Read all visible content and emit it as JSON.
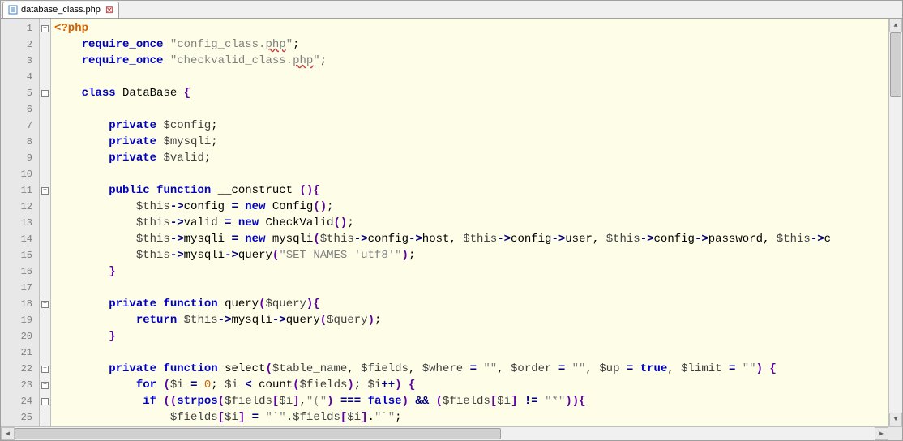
{
  "tab": {
    "filename": "database_class.php",
    "close_glyph": "⊠"
  },
  "gutter": {
    "start": 1,
    "end": 25
  },
  "fold_markers": {
    "1": "minus",
    "5": "minus",
    "11": "minus",
    "18": "minus",
    "22": "minus",
    "23": "minus",
    "24": "minus"
  },
  "code": {
    "lines": [
      [
        {
          "t": "tag",
          "v": "<?php"
        }
      ],
      [
        {
          "t": "sp",
          "v": "    "
        },
        {
          "t": "keyword",
          "v": "require_once"
        },
        {
          "t": "sp",
          "v": " "
        },
        {
          "t": "string",
          "v": "\"config_class."
        },
        {
          "t": "err",
          "v": "php"
        },
        {
          "t": "string",
          "v": "\""
        },
        {
          "t": "ident",
          "v": ";"
        }
      ],
      [
        {
          "t": "sp",
          "v": "    "
        },
        {
          "t": "keyword",
          "v": "require_once"
        },
        {
          "t": "sp",
          "v": " "
        },
        {
          "t": "string",
          "v": "\"checkvalid_class."
        },
        {
          "t": "err",
          "v": "php"
        },
        {
          "t": "string",
          "v": "\""
        },
        {
          "t": "ident",
          "v": ";"
        }
      ],
      [],
      [
        {
          "t": "sp",
          "v": "    "
        },
        {
          "t": "keyword",
          "v": "class"
        },
        {
          "t": "sp",
          "v": " "
        },
        {
          "t": "ident",
          "v": "DataBase "
        },
        {
          "t": "paren",
          "v": "{"
        }
      ],
      [],
      [
        {
          "t": "sp",
          "v": "        "
        },
        {
          "t": "keyword",
          "v": "private"
        },
        {
          "t": "sp",
          "v": " "
        },
        {
          "t": "var",
          "v": "$config"
        },
        {
          "t": "ident",
          "v": ";"
        }
      ],
      [
        {
          "t": "sp",
          "v": "        "
        },
        {
          "t": "keyword",
          "v": "private"
        },
        {
          "t": "sp",
          "v": " "
        },
        {
          "t": "var",
          "v": "$mysqli"
        },
        {
          "t": "ident",
          "v": ";"
        }
      ],
      [
        {
          "t": "sp",
          "v": "        "
        },
        {
          "t": "keyword",
          "v": "private"
        },
        {
          "t": "sp",
          "v": " "
        },
        {
          "t": "var",
          "v": "$valid"
        },
        {
          "t": "ident",
          "v": ";"
        }
      ],
      [],
      [
        {
          "t": "sp",
          "v": "        "
        },
        {
          "t": "keyword",
          "v": "public"
        },
        {
          "t": "sp",
          "v": " "
        },
        {
          "t": "keyword",
          "v": "function"
        },
        {
          "t": "sp",
          "v": " "
        },
        {
          "t": "func",
          "v": "__construct "
        },
        {
          "t": "paren",
          "v": "()"
        },
        {
          "t": "paren",
          "v": "{"
        }
      ],
      [
        {
          "t": "sp",
          "v": "            "
        },
        {
          "t": "var",
          "v": "$this"
        },
        {
          "t": "op",
          "v": "->"
        },
        {
          "t": "ident",
          "v": "config "
        },
        {
          "t": "op",
          "v": "="
        },
        {
          "t": "sp",
          "v": " "
        },
        {
          "t": "keyword",
          "v": "new"
        },
        {
          "t": "sp",
          "v": " "
        },
        {
          "t": "ident",
          "v": "Config"
        },
        {
          "t": "paren",
          "v": "()"
        },
        {
          "t": "ident",
          "v": ";"
        }
      ],
      [
        {
          "t": "sp",
          "v": "            "
        },
        {
          "t": "var",
          "v": "$this"
        },
        {
          "t": "op",
          "v": "->"
        },
        {
          "t": "ident",
          "v": "valid "
        },
        {
          "t": "op",
          "v": "="
        },
        {
          "t": "sp",
          "v": " "
        },
        {
          "t": "keyword",
          "v": "new"
        },
        {
          "t": "sp",
          "v": " "
        },
        {
          "t": "ident",
          "v": "CheckValid"
        },
        {
          "t": "paren",
          "v": "()"
        },
        {
          "t": "ident",
          "v": ";"
        }
      ],
      [
        {
          "t": "sp",
          "v": "            "
        },
        {
          "t": "var",
          "v": "$this"
        },
        {
          "t": "op",
          "v": "->"
        },
        {
          "t": "ident",
          "v": "mysqli "
        },
        {
          "t": "op",
          "v": "="
        },
        {
          "t": "sp",
          "v": " "
        },
        {
          "t": "keyword",
          "v": "new"
        },
        {
          "t": "sp",
          "v": " "
        },
        {
          "t": "ident",
          "v": "mysqli"
        },
        {
          "t": "paren",
          "v": "("
        },
        {
          "t": "var",
          "v": "$this"
        },
        {
          "t": "op",
          "v": "->"
        },
        {
          "t": "ident",
          "v": "config"
        },
        {
          "t": "op",
          "v": "->"
        },
        {
          "t": "ident",
          "v": "host"
        },
        {
          "t": "ident",
          "v": ", "
        },
        {
          "t": "var",
          "v": "$this"
        },
        {
          "t": "op",
          "v": "->"
        },
        {
          "t": "ident",
          "v": "config"
        },
        {
          "t": "op",
          "v": "->"
        },
        {
          "t": "ident",
          "v": "user"
        },
        {
          "t": "ident",
          "v": ", "
        },
        {
          "t": "var",
          "v": "$this"
        },
        {
          "t": "op",
          "v": "->"
        },
        {
          "t": "ident",
          "v": "config"
        },
        {
          "t": "op",
          "v": "->"
        },
        {
          "t": "ident",
          "v": "password"
        },
        {
          "t": "ident",
          "v": ", "
        },
        {
          "t": "var",
          "v": "$this"
        },
        {
          "t": "op",
          "v": "->"
        },
        {
          "t": "ident",
          "v": "c"
        }
      ],
      [
        {
          "t": "sp",
          "v": "            "
        },
        {
          "t": "var",
          "v": "$this"
        },
        {
          "t": "op",
          "v": "->"
        },
        {
          "t": "ident",
          "v": "mysqli"
        },
        {
          "t": "op",
          "v": "->"
        },
        {
          "t": "ident",
          "v": "query"
        },
        {
          "t": "paren",
          "v": "("
        },
        {
          "t": "string",
          "v": "\"SET NAMES 'utf8'\""
        },
        {
          "t": "paren",
          "v": ")"
        },
        {
          "t": "ident",
          "v": ";"
        }
      ],
      [
        {
          "t": "sp",
          "v": "        "
        },
        {
          "t": "paren",
          "v": "}"
        }
      ],
      [],
      [
        {
          "t": "sp",
          "v": "        "
        },
        {
          "t": "keyword",
          "v": "private"
        },
        {
          "t": "sp",
          "v": " "
        },
        {
          "t": "keyword",
          "v": "function"
        },
        {
          "t": "sp",
          "v": " "
        },
        {
          "t": "func",
          "v": "query"
        },
        {
          "t": "paren",
          "v": "("
        },
        {
          "t": "var",
          "v": "$query"
        },
        {
          "t": "paren",
          "v": ")"
        },
        {
          "t": "paren",
          "v": "{"
        }
      ],
      [
        {
          "t": "sp",
          "v": "            "
        },
        {
          "t": "keyword",
          "v": "return"
        },
        {
          "t": "sp",
          "v": " "
        },
        {
          "t": "var",
          "v": "$this"
        },
        {
          "t": "op",
          "v": "->"
        },
        {
          "t": "ident",
          "v": "mysqli"
        },
        {
          "t": "op",
          "v": "->"
        },
        {
          "t": "ident",
          "v": "query"
        },
        {
          "t": "paren",
          "v": "("
        },
        {
          "t": "var",
          "v": "$query"
        },
        {
          "t": "paren",
          "v": ")"
        },
        {
          "t": "ident",
          "v": ";"
        }
      ],
      [
        {
          "t": "sp",
          "v": "        "
        },
        {
          "t": "paren",
          "v": "}"
        }
      ],
      [],
      [
        {
          "t": "sp",
          "v": "        "
        },
        {
          "t": "keyword",
          "v": "private"
        },
        {
          "t": "sp",
          "v": " "
        },
        {
          "t": "keyword",
          "v": "function"
        },
        {
          "t": "sp",
          "v": " "
        },
        {
          "t": "func",
          "v": "select"
        },
        {
          "t": "paren",
          "v": "("
        },
        {
          "t": "var",
          "v": "$table_name"
        },
        {
          "t": "ident",
          "v": ", "
        },
        {
          "t": "var",
          "v": "$fields"
        },
        {
          "t": "ident",
          "v": ", "
        },
        {
          "t": "var",
          "v": "$where"
        },
        {
          "t": "sp",
          "v": " "
        },
        {
          "t": "op",
          "v": "="
        },
        {
          "t": "sp",
          "v": " "
        },
        {
          "t": "string",
          "v": "\"\""
        },
        {
          "t": "ident",
          "v": ", "
        },
        {
          "t": "var",
          "v": "$order"
        },
        {
          "t": "sp",
          "v": " "
        },
        {
          "t": "op",
          "v": "="
        },
        {
          "t": "sp",
          "v": " "
        },
        {
          "t": "string",
          "v": "\"\""
        },
        {
          "t": "ident",
          "v": ", "
        },
        {
          "t": "var",
          "v": "$up"
        },
        {
          "t": "sp",
          "v": " "
        },
        {
          "t": "op",
          "v": "="
        },
        {
          "t": "sp",
          "v": " "
        },
        {
          "t": "keyword",
          "v": "true"
        },
        {
          "t": "ident",
          "v": ", "
        },
        {
          "t": "var",
          "v": "$limit"
        },
        {
          "t": "sp",
          "v": " "
        },
        {
          "t": "op",
          "v": "="
        },
        {
          "t": "sp",
          "v": " "
        },
        {
          "t": "string",
          "v": "\"\""
        },
        {
          "t": "paren",
          "v": ")"
        },
        {
          "t": "sp",
          "v": " "
        },
        {
          "t": "paren",
          "v": "{"
        }
      ],
      [
        {
          "t": "sp",
          "v": "            "
        },
        {
          "t": "keyword",
          "v": "for"
        },
        {
          "t": "sp",
          "v": " "
        },
        {
          "t": "paren",
          "v": "("
        },
        {
          "t": "var",
          "v": "$i"
        },
        {
          "t": "sp",
          "v": " "
        },
        {
          "t": "op",
          "v": "="
        },
        {
          "t": "sp",
          "v": " "
        },
        {
          "t": "num",
          "v": "0"
        },
        {
          "t": "ident",
          "v": "; "
        },
        {
          "t": "var",
          "v": "$i"
        },
        {
          "t": "sp",
          "v": " "
        },
        {
          "t": "op",
          "v": "<"
        },
        {
          "t": "sp",
          "v": " "
        },
        {
          "t": "ident",
          "v": "count"
        },
        {
          "t": "paren",
          "v": "("
        },
        {
          "t": "var",
          "v": "$fields"
        },
        {
          "t": "paren",
          "v": ")"
        },
        {
          "t": "ident",
          "v": "; "
        },
        {
          "t": "var",
          "v": "$i"
        },
        {
          "t": "op",
          "v": "++"
        },
        {
          "t": "paren",
          "v": ")"
        },
        {
          "t": "sp",
          "v": " "
        },
        {
          "t": "paren",
          "v": "{"
        }
      ],
      [
        {
          "t": "sp",
          "v": "             "
        },
        {
          "t": "keyword",
          "v": "if"
        },
        {
          "t": "sp",
          "v": " "
        },
        {
          "t": "paren",
          "v": "(("
        },
        {
          "t": "keyword",
          "v": "strpos"
        },
        {
          "t": "paren",
          "v": "("
        },
        {
          "t": "var",
          "v": "$fields"
        },
        {
          "t": "paren",
          "v": "["
        },
        {
          "t": "var",
          "v": "$i"
        },
        {
          "t": "paren",
          "v": "]"
        },
        {
          "t": "ident",
          "v": ","
        },
        {
          "t": "string",
          "v": "\"(\""
        },
        {
          "t": "paren",
          "v": ")"
        },
        {
          "t": "sp",
          "v": " "
        },
        {
          "t": "op",
          "v": "==="
        },
        {
          "t": "sp",
          "v": " "
        },
        {
          "t": "keyword",
          "v": "false"
        },
        {
          "t": "paren",
          "v": ")"
        },
        {
          "t": "sp",
          "v": " "
        },
        {
          "t": "op",
          "v": "&&"
        },
        {
          "t": "sp",
          "v": " "
        },
        {
          "t": "paren",
          "v": "("
        },
        {
          "t": "var",
          "v": "$fields"
        },
        {
          "t": "paren",
          "v": "["
        },
        {
          "t": "var",
          "v": "$i"
        },
        {
          "t": "paren",
          "v": "]"
        },
        {
          "t": "sp",
          "v": " "
        },
        {
          "t": "op",
          "v": "!="
        },
        {
          "t": "sp",
          "v": " "
        },
        {
          "t": "string",
          "v": "\"*\""
        },
        {
          "t": "paren",
          "v": "))"
        },
        {
          "t": "paren",
          "v": "{"
        }
      ],
      [
        {
          "t": "sp",
          "v": "                 "
        },
        {
          "t": "var",
          "v": "$fields"
        },
        {
          "t": "paren",
          "v": "["
        },
        {
          "t": "var",
          "v": "$i"
        },
        {
          "t": "paren",
          "v": "]"
        },
        {
          "t": "sp",
          "v": " "
        },
        {
          "t": "op",
          "v": "="
        },
        {
          "t": "sp",
          "v": " "
        },
        {
          "t": "string",
          "v": "\"`\""
        },
        {
          "t": "ident",
          "v": "."
        },
        {
          "t": "var",
          "v": "$fields"
        },
        {
          "t": "paren",
          "v": "["
        },
        {
          "t": "var",
          "v": "$i"
        },
        {
          "t": "paren",
          "v": "]"
        },
        {
          "t": "ident",
          "v": "."
        },
        {
          "t": "string",
          "v": "\"`\""
        },
        {
          "t": "ident",
          "v": ";"
        }
      ]
    ]
  }
}
